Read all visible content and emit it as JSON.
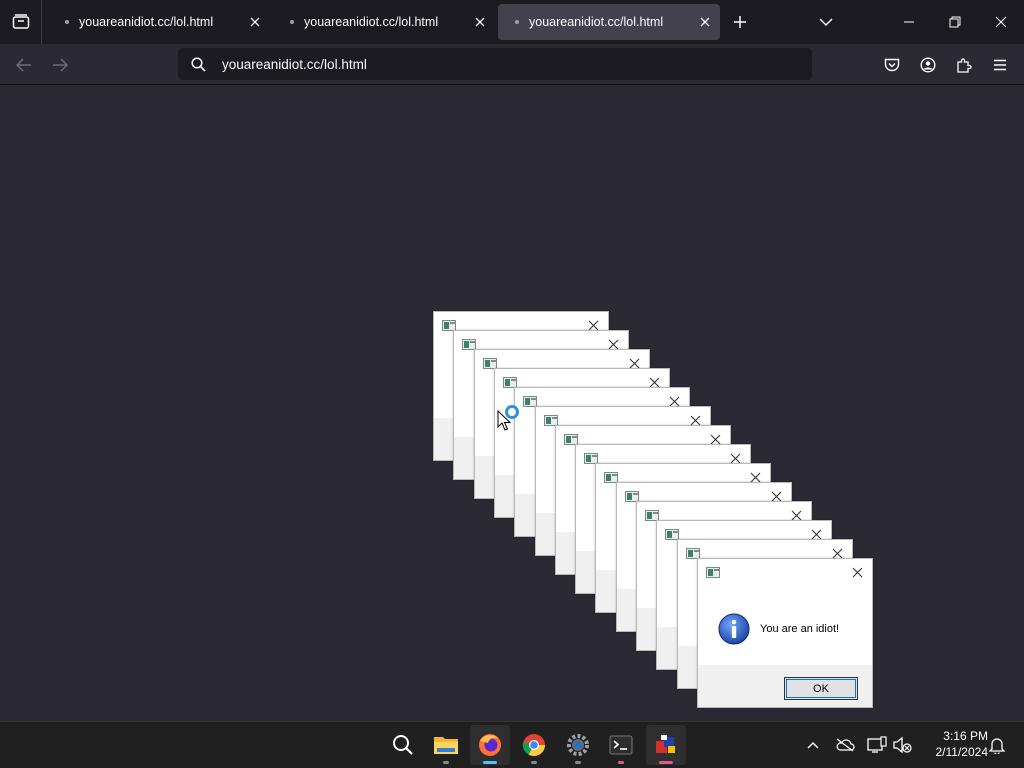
{
  "browser": {
    "tabs": [
      {
        "title": "youareanidiot.cc/lol.html",
        "active": false
      },
      {
        "title": "youareanidiot.cc/lol.html",
        "active": false
      },
      {
        "title": "youareanidiot.cc/lol.html",
        "active": true
      }
    ],
    "url": "youareanidiot.cc/lol.html"
  },
  "dialog": {
    "message": "You are an idiot!",
    "ok_label": "OK",
    "stack_count": 14
  },
  "taskbar": {
    "apps": [
      "search-icon",
      "file-explorer-icon",
      "firefox-icon",
      "chrome-icon",
      "settings-icon",
      "terminal-icon",
      "app-icon"
    ],
    "active_app": "firefox-icon"
  },
  "clock": {
    "time": "3:16 PM",
    "date": "2/11/2024"
  },
  "colors": {
    "tabbar_bg": "#1c1b22",
    "content_bg": "#2b2a33",
    "active_tab": "#42414d",
    "taskbar_bg": "#202020",
    "accent": "#4cc2ff"
  }
}
